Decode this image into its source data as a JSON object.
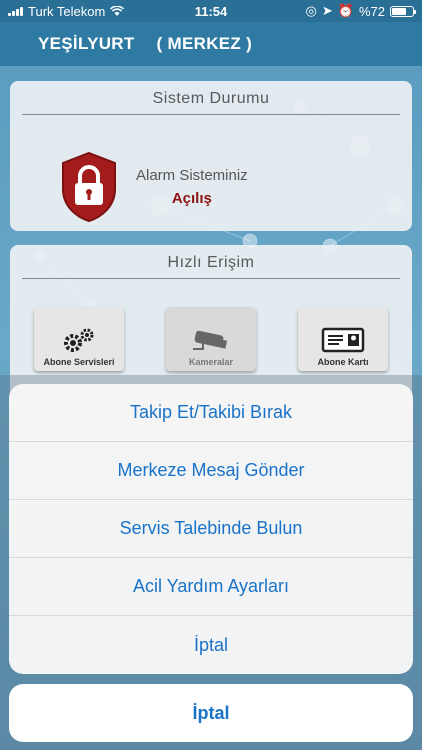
{
  "status_bar": {
    "carrier": "Turk Telekom",
    "time": "11:54",
    "battery": "%72",
    "battery_level": 0.72
  },
  "header": {
    "location": "YEŞİLYURT",
    "branch": "( MERKEZ )"
  },
  "system_status": {
    "title": "Sistem Durumu",
    "alarm_label": "Alarm Sisteminiz",
    "alarm_status": "Açılış",
    "icon": "lock-shield-icon"
  },
  "quick_access": {
    "title": "Hızlı Erişim",
    "buttons": [
      {
        "label": "Abone Servisleri",
        "icon": "gears-icon"
      },
      {
        "label": "Kameralar",
        "icon": "camera-icon"
      },
      {
        "label": "Abone Kartı",
        "icon": "id-card-icon"
      }
    ]
  },
  "action_sheet": {
    "items": [
      "Takip Et/Takibi Bırak",
      "Merkeze Mesaj Gönder",
      "Servis Talebinde Bulun",
      "Acil Yardım Ayarları",
      "İptal"
    ],
    "cancel": "İptal"
  },
  "colors": {
    "header": "#2f7aa3",
    "action_text": "#1a73c8",
    "alarm_status": "#8f1313",
    "shield": "#a31b1b"
  }
}
